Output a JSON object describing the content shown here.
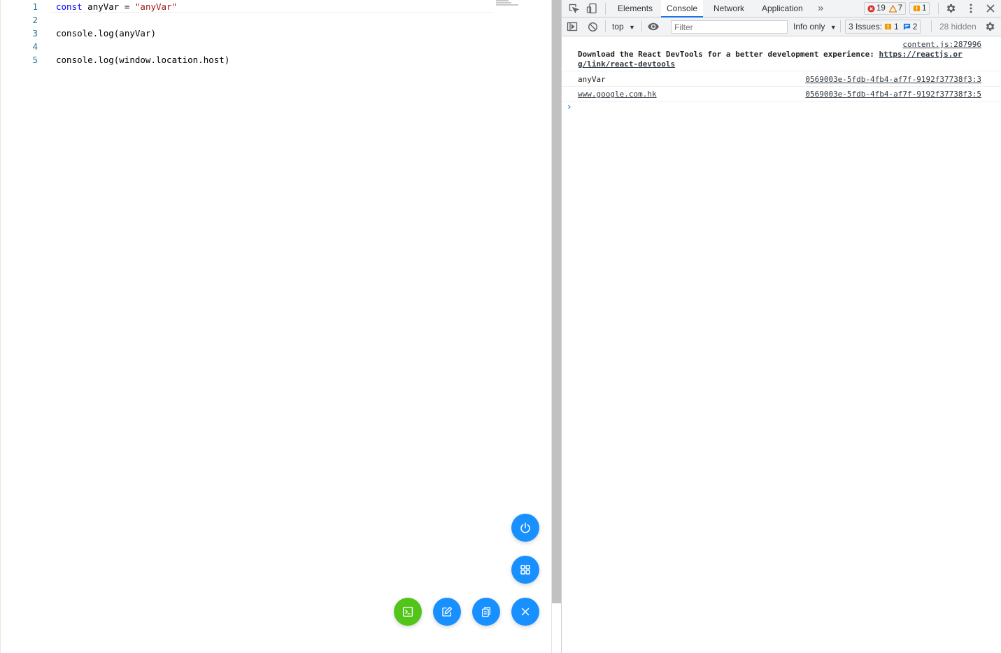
{
  "editor": {
    "lines": [
      {
        "no": "1",
        "parts": [
          {
            "t": "const",
            "c": "kw"
          },
          {
            "t": " anyVar = ",
            "c": ""
          },
          {
            "t": "\"anyVar\"",
            "c": "str"
          }
        ]
      },
      {
        "no": "2",
        "parts": []
      },
      {
        "no": "3",
        "parts": [
          {
            "t": "console.log(anyVar)",
            "c": ""
          }
        ]
      },
      {
        "no": "4",
        "parts": []
      },
      {
        "no": "5",
        "parts": [
          {
            "t": "console.log(window.location.host)",
            "c": ""
          }
        ]
      }
    ]
  },
  "fabs": {
    "power": "power-icon",
    "grid": "grid-icon",
    "terminal": "terminal-icon",
    "edit": "edit-icon",
    "clipboard": "clipboard-icon",
    "close": "close-icon",
    "colors": {
      "blue": "#1890ff",
      "green": "#52c41a"
    }
  },
  "devtools": {
    "tabs": [
      "Elements",
      "Console",
      "Network",
      "Application"
    ],
    "active_tab": "Console",
    "more_tabs": "»",
    "errors": "19",
    "warnings": "7",
    "issues_count": "1",
    "context": "top",
    "filter_placeholder": "Filter",
    "level": "Info only",
    "issues_label": "3 Issues:",
    "issues_warn": "1",
    "issues_info": "2",
    "hidden": "28 hidden",
    "accent": "#1a73e8"
  },
  "console": {
    "messages": [
      {
        "source": "content.js:287996",
        "text": "Download the React DevTools for a better development experience: ",
        "link": "https://reactjs.or",
        "link_cont": "g/link/react-devtools"
      },
      {
        "text": "anyVar",
        "source": "0569003e-5fdb-4fb4-af7f-9192f37738f3:3"
      },
      {
        "text": "www.google.com.hk",
        "source": "0569003e-5fdb-4fb4-af7f-9192f37738f3:5"
      }
    ],
    "prompt": "›"
  }
}
